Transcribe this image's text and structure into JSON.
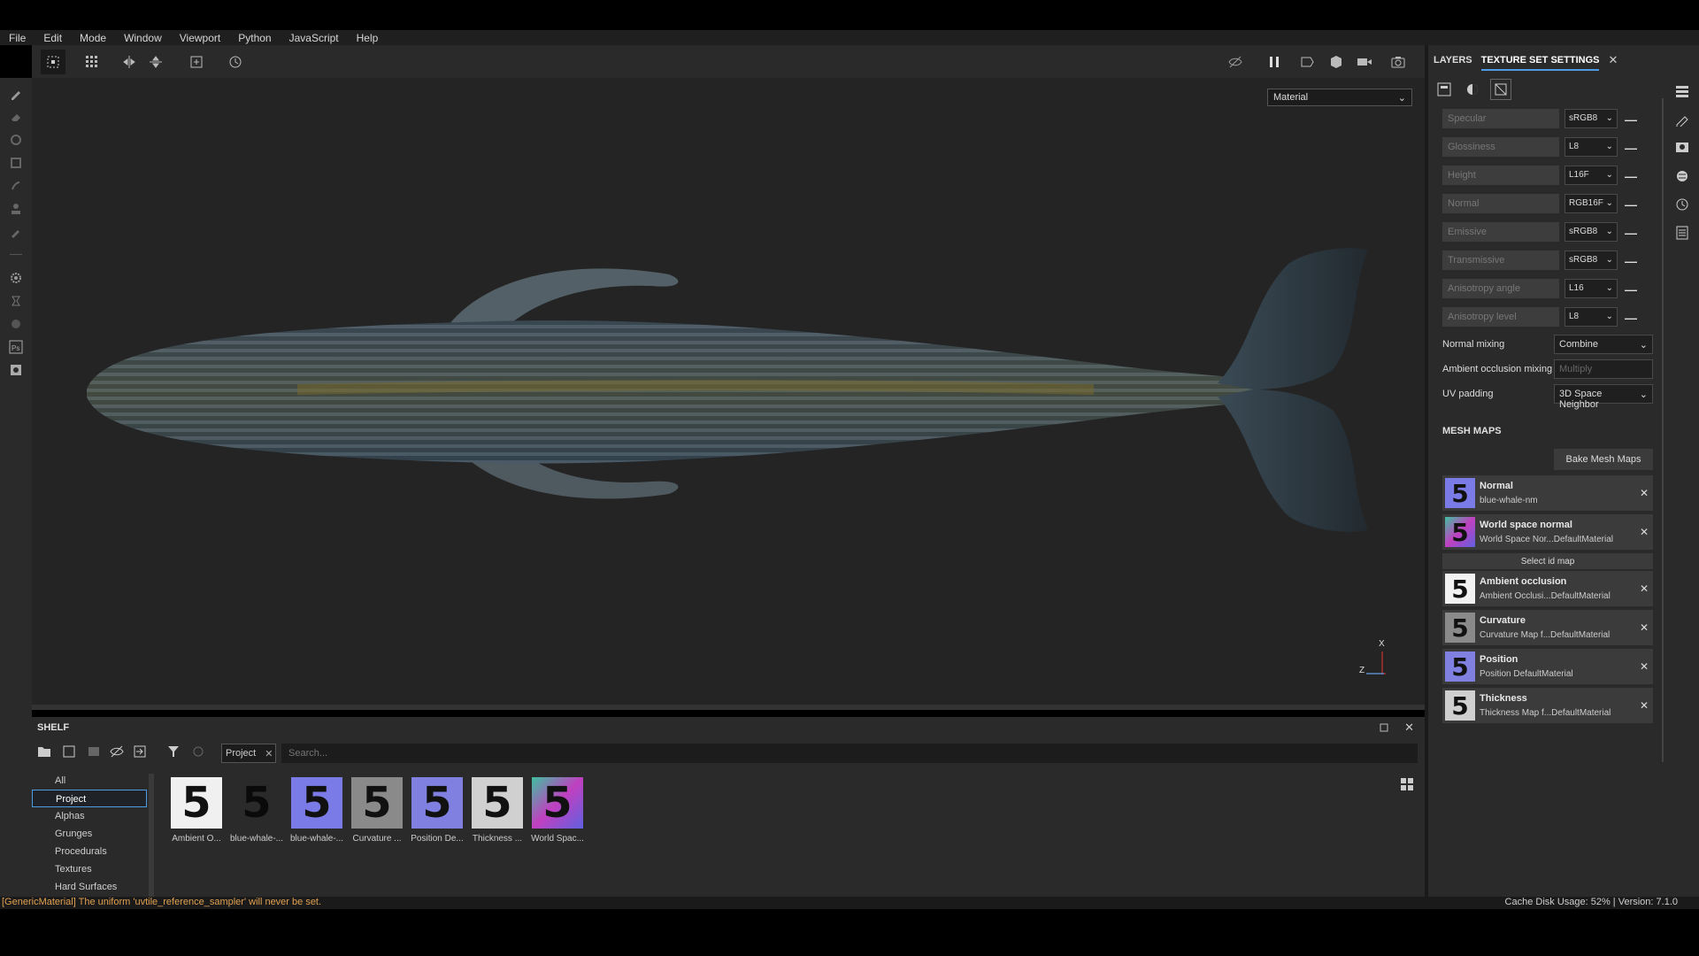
{
  "menu": [
    "File",
    "Edit",
    "Mode",
    "Window",
    "Viewport",
    "Python",
    "JavaScript",
    "Help"
  ],
  "viewport": {
    "material_select": "Material",
    "axis_labels": {
      "x": "X",
      "z": "Z"
    }
  },
  "right_panel": {
    "tabs": [
      {
        "label": "LAYERS"
      },
      {
        "label": "TEXTURE SET SETTINGS",
        "active": true
      }
    ],
    "close": "✕",
    "channels": [
      {
        "name": "Specular",
        "format": "sRGB8"
      },
      {
        "name": "Glossiness",
        "format": "L8"
      },
      {
        "name": "Height",
        "format": "L16F"
      },
      {
        "name": "Normal",
        "format": "RGB16F"
      },
      {
        "name": "Emissive",
        "format": "sRGB8"
      },
      {
        "name": "Transmissive",
        "format": "sRGB8"
      },
      {
        "name": "Anisotropy angle",
        "format": "L16"
      },
      {
        "name": "Anisotropy level",
        "format": "L8"
      }
    ],
    "normal_mixing": {
      "label": "Normal mixing",
      "value": "Combine"
    },
    "ao_mixing": {
      "label": "Ambient occlusion mixing",
      "value": "Multiply"
    },
    "uv_padding": {
      "label": "UV padding",
      "value": "3D Space Neighbor"
    },
    "mesh_maps_title": "MESH MAPS",
    "bake_button": "Bake Mesh Maps",
    "select_id_map": "Select id map",
    "mesh_maps": [
      {
        "title": "Normal",
        "sub": "blue-whale-nm",
        "color": "#7b7be8"
      },
      {
        "title": "World space normal",
        "sub": "World Space Nor...DefaultMaterial",
        "color": "#c040c0"
      },
      {
        "title": "Ambient occlusion",
        "sub": "Ambient Occlusi...DefaultMaterial",
        "color": "#f2f2f2"
      },
      {
        "title": "Curvature",
        "sub": "Curvature Map f...DefaultMaterial",
        "color": "#8a8a8a"
      },
      {
        "title": "Position",
        "sub": "Position DefaultMaterial",
        "color": "#8080e0"
      },
      {
        "title": "Thickness",
        "sub": "Thickness Map f...DefaultMaterial",
        "color": "#cfcfcf"
      }
    ]
  },
  "shelf": {
    "title": "SHELF",
    "chip": "Project",
    "chip_close": "✕",
    "search_placeholder": "Search...",
    "categories": [
      "All",
      "Project",
      "Alphas",
      "Grunges",
      "Procedurals",
      "Textures",
      "Hard Surfaces"
    ],
    "selected_category": "Project",
    "items": [
      {
        "label": "Ambient O...",
        "color": "#f0f0f0"
      },
      {
        "label": "blue-whale-...",
        "color": "#2a2a2a"
      },
      {
        "label": "blue-whale-...",
        "color": "#7b7be8"
      },
      {
        "label": "Curvature ...",
        "color": "#8a8a8a"
      },
      {
        "label": "Position De...",
        "color": "#8080e0"
      },
      {
        "label": "Thickness ...",
        "color": "#d0d0d0"
      },
      {
        "label": "World Spac...",
        "color": "#c040c0"
      }
    ]
  },
  "status": {
    "message": "[GenericMaterial] The uniform 'uvtile_reference_sampler' will never be set.",
    "right": "Cache Disk Usage:     52% | Version: 7.1.0"
  }
}
